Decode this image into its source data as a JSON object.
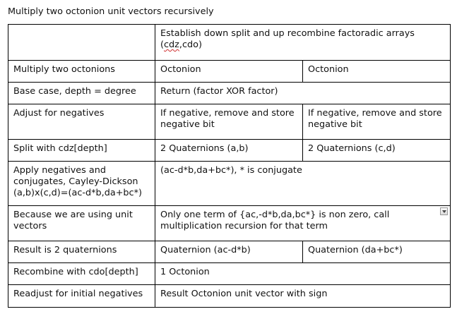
{
  "title": "Multiply two octonion unit vectors recursively",
  "header": {
    "text_prefix": "Establish down split and up recombine factoradic arrays (",
    "text_misspelled": "cdz",
    "text_suffix": ",cdo)"
  },
  "rows": [
    {
      "label": "Multiply two octonions",
      "col2": "Octonion",
      "col3": "Octonion"
    },
    {
      "label": "Base case, depth = degree",
      "col2": "Return (factor XOR factor)"
    },
    {
      "label": "Adjust for negatives",
      "col2": "If negative, remove and store negative bit",
      "col3": "If negative, remove and store negative bit"
    },
    {
      "label": "Split with cdz[depth]",
      "col2": "2 Quaternions (a,b)",
      "col3": "2 Quaternions (c,d)"
    },
    {
      "label": "Apply negatives and conjugates, Cayley-Dickson (a,b)x(c,d)=(ac-d*b,da+bc*)",
      "col2": "(ac-d*b,da+bc*), * is conjugate"
    },
    {
      "label": "Because we are using unit vectors",
      "col2": "Only one term of {ac,-d*b,da,bc*} is non zero, call multiplication recursion for that term"
    },
    {
      "label": "Result is 2 quaternions",
      "col2": "Quaternion (ac-d*b)",
      "col3": "Quaternion (da+bc*)"
    },
    {
      "label": "Recombine with cdo[depth]",
      "col2": "1 Octonion"
    },
    {
      "label": "Readjust for initial negatives",
      "col2": "Result Octonion unit vector with sign"
    }
  ],
  "icons": {
    "dropdown": "dropdown-arrow-icon"
  }
}
